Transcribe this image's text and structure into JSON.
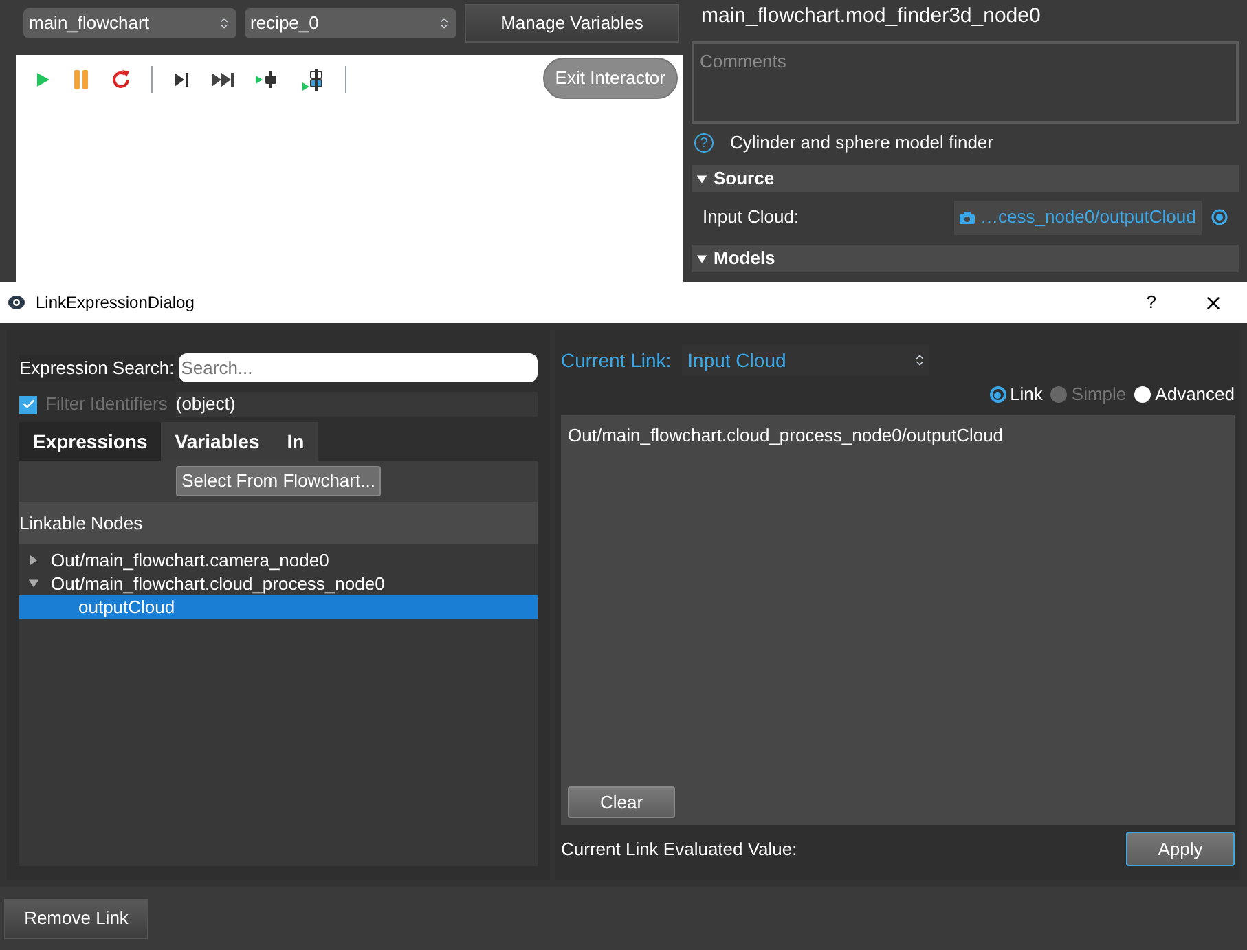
{
  "app": {
    "flowchart_select": "main_flowchart",
    "recipe_select": "recipe_0",
    "manage_button": "Manage Variables",
    "exit_button": "Exit Interactor",
    "remove_button": "Remove Link"
  },
  "node_panel": {
    "title": "main_flowchart.mod_finder3d_node0",
    "comments": {
      "placeholder": "Comments"
    },
    "help_mark": "?",
    "description": "Cylinder and sphere model finder",
    "sections": [
      {
        "title": "Source",
        "expanded": true,
        "fields": [
          {
            "label": "Input Cloud:",
            "value": "…cess_node0/outputCloud"
          }
        ]
      },
      {
        "title": "Models",
        "expanded": true
      }
    ]
  },
  "dialog": {
    "title": "LinkExpressionDialog",
    "help": "?",
    "search": {
      "label": "Expression Search:",
      "placeholder": "Search..."
    },
    "filter": {
      "label": "Filter Identifiers",
      "checked": true,
      "disabled": true,
      "type": "(object)"
    },
    "tabs": [
      {
        "label": "Expressions",
        "selected": true
      },
      {
        "label": "Variables",
        "selected": false
      },
      {
        "label": "In",
        "selected": false
      }
    ],
    "select_button": "Select From Flowchart...",
    "tree_header": "Linkable Nodes",
    "nodes": [
      {
        "label": "Out/main_flowchart.camera_node0",
        "expanded": false,
        "selected": false
      },
      {
        "label": "Out/main_flowchart.cloud_process_node0",
        "expanded": true,
        "selected": false,
        "children": [
          {
            "label": "outputCloud",
            "selected": true
          }
        ]
      }
    ],
    "current_link": {
      "label": "Current Link:",
      "value": "Input Cloud"
    },
    "modes": [
      {
        "label": "Link",
        "selected": true,
        "disabled": false
      },
      {
        "label": "Simple",
        "selected": false,
        "disabled": true
      },
      {
        "label": "Advanced",
        "selected": false,
        "disabled": false
      }
    ],
    "expression": "Out/main_flowchart.cloud_process_node0/outputCloud",
    "clear_button": "Clear",
    "evaluated_label": "Current Link Evaluated Value:",
    "apply_button": "Apply"
  }
}
